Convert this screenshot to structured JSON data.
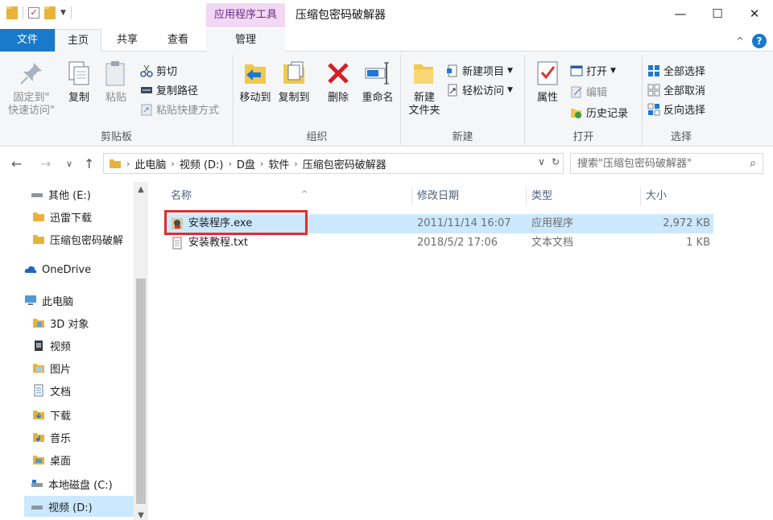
{
  "window": {
    "title": "压缩包密码破解器",
    "context_tab": "应用程序工具",
    "controls": {
      "minimize": "—",
      "maximize": "☐",
      "close": "✕"
    }
  },
  "tabs": {
    "file": "文件",
    "home": "主页",
    "share": "共享",
    "view": "查看",
    "manage": "管理",
    "collapse": "^",
    "help": "?"
  },
  "ribbon": {
    "clipboard": {
      "label": "剪贴板",
      "pin_line1": "固定到\"",
      "pin_line2": "快速访问\"",
      "copy": "复制",
      "paste": "粘贴",
      "cut": "剪切",
      "copy_path": "复制路径",
      "paste_shortcut": "粘贴快捷方式"
    },
    "organize": {
      "label": "组织",
      "move_to": "移动到",
      "copy_to": "复制到",
      "delete": "删除",
      "rename": "重命名"
    },
    "new": {
      "label": "新建",
      "new_folder_line1": "新建",
      "new_folder_line2": "文件夹",
      "new_item": "新建项目",
      "easy_access": "轻松访问"
    },
    "open": {
      "label": "打开",
      "properties": "属性",
      "open": "打开",
      "edit": "编辑",
      "history": "历史记录"
    },
    "select": {
      "label": "选择",
      "select_all": "全部选择",
      "select_none": "全部取消",
      "invert": "反向选择"
    }
  },
  "address": {
    "crumbs": [
      "此电脑",
      "视频 (D:)",
      "D盘",
      "软件",
      "压缩包密码破解器"
    ],
    "search_placeholder": "搜索\"压缩包密码破解器\""
  },
  "navpane": {
    "items": [
      {
        "label": "其他 (E:)",
        "icon": "drive-icon"
      },
      {
        "label": "迅雷下载",
        "icon": "folder-icon"
      },
      {
        "label": "压缩包密码破解",
        "icon": "folder-icon"
      },
      {
        "label": "OneDrive",
        "icon": "cloud-icon"
      },
      {
        "label": "此电脑",
        "icon": "computer-icon"
      },
      {
        "label": "3D 对象",
        "icon": "3d-objects-icon"
      },
      {
        "label": "视频",
        "icon": "video-icon"
      },
      {
        "label": "图片",
        "icon": "pictures-icon"
      },
      {
        "label": "文档",
        "icon": "documents-icon"
      },
      {
        "label": "下载",
        "icon": "downloads-icon"
      },
      {
        "label": "音乐",
        "icon": "music-icon"
      },
      {
        "label": "桌面",
        "icon": "desktop-icon"
      },
      {
        "label": "本地磁盘 (C:)",
        "icon": "drive-icon"
      },
      {
        "label": "视频 (D:)",
        "icon": "drive-icon"
      }
    ]
  },
  "filelist": {
    "columns": {
      "name": "名称",
      "modified": "修改日期",
      "type": "类型",
      "size": "大小"
    },
    "rows": [
      {
        "name": "安装程序.exe",
        "modified": "2011/11/14 16:07",
        "type": "应用程序",
        "size": "2,972 KB",
        "icon": "installer-icon"
      },
      {
        "name": "安装教程.txt",
        "modified": "2018/5/2 17:06",
        "type": "文本文档",
        "size": "1 KB",
        "icon": "text-file-icon"
      }
    ]
  },
  "colors": {
    "accent": "#1979ca",
    "selection": "#cce8ff",
    "context_tab": "#f2d8f5",
    "highlight": "#e52b2b"
  }
}
